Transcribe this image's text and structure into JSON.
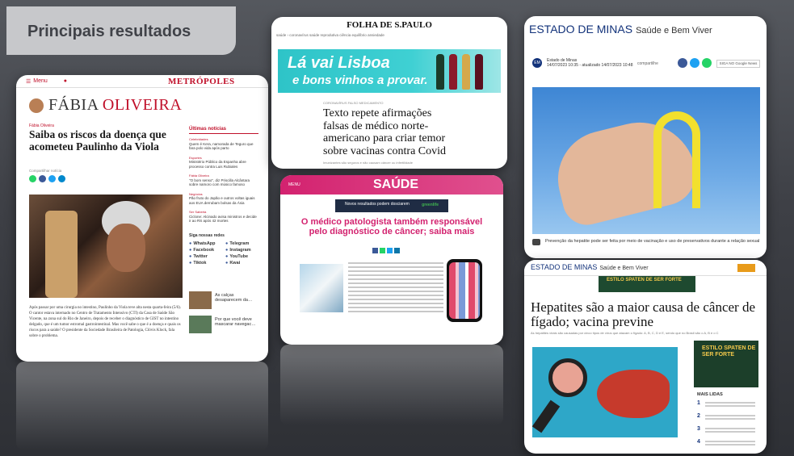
{
  "title": "Principais resultados",
  "colors": {
    "accent": "#c0102a",
    "saude": "#d3226f",
    "estado": "#12327a",
    "folha_ad": "#2ec4c8"
  },
  "metropoles": {
    "menu": "Menu",
    "logo": "METRÓPOLES",
    "author_first": "FÁBIA",
    "author_last": "OLIVEIRA",
    "category": "Fábia Oliveira",
    "headline": "Saiba os riscos da doença que acometeu Paulinho da Viola",
    "share_label": "Compartilhar notícia",
    "sidebar_title": "Últimas notícias",
    "sidebar_items": [
      {
        "tag": "Celebridades",
        "text": "Quem é Kera, namorada de Teguro que fara polo vida após parto"
      },
      {
        "tag": "Esportes",
        "text": "Ministério Público da Espanha abre processo contra Luis Rubiales"
      },
      {
        "tag": "Fábia Oliveira",
        "text": "\"O bom senso\", diz Priscilla Alcântara sobre namoro com músico famoso"
      },
      {
        "tag": "Negócios",
        "text": "Pão fruto do Japão e outros voltas iguais aos EUA derrubam bolsas da Ásia"
      },
      {
        "tag": "Ser Saberta",
        "text": "Ciclone: Alcinado avisa ministros e decide ir ao RS após 42 mortes"
      }
    ],
    "social_title": "Siga nossas redes",
    "social": [
      "WhatsApp",
      "Telegram",
      "Facebook",
      "Instagram",
      "Twitter",
      "YouTube",
      "Tiktok",
      "Kwai"
    ],
    "related": [
      {
        "text": "As calças desaparecem da…"
      },
      {
        "text": "Por que você deve mascarar navegac…"
      }
    ],
    "body": "Após passar por uma cirurgia no intestino, Paulinho da Viola teve alta nesta quarta-feira (5/6). O cantor estava internado no Centro de Tratamento Intensivo (CTI) da Casa de Saúde São Vicente, na zona sul do Rio de Janeiro, depois de receber o diagnóstico de GIST no intestino delgado, que é um tumor estromal gastrointestinal. Mas você sabe o que é a doença e quais os riscos para a saúde? O presidente da Sociedade Brasileira de Patologia, Clóvis Klock, fala sobre o problema."
  },
  "folha": {
    "logo": "FOLHA DE S.PAULO",
    "nav": "saúde  ›  coronavírus  saúde reprodutiva  ciência  equilíbrio  ansiedade",
    "ad_line1": "Lá vai Lisboa",
    "ad_line2": "e bons vinhos a provar.",
    "tags": "CORONAVÍRUS   FALSO MEDICAMENTO",
    "headline": "Texto repete afirmações falsas de médico norte-americano para criar temor sobre vacinas contra Covid",
    "sub": "Imunizantes são seguros e não causam câncer ou infertilidade"
  },
  "saude": {
    "menu": "MENU",
    "logo": "SAÚDE",
    "ad_left": "Novos resultados podem dosciarem",
    "ad_right": "greenlife",
    "headline": "O médico patologista também responsável pelo diagnóstico de câncer; saiba mais"
  },
  "estado_top": {
    "logo": "ESTADO DE MINAS",
    "section": "Saúde e Bem Viver",
    "author": "Estado de Minas",
    "date": "14/07/2023 10:35 - atualizado 14/07/2023 10:48",
    "share": "compartilhe",
    "google": "SIGA NO Google News",
    "caption": "Prevenção da hepatite pode ser feita por meio de vacinação e uso de preservativos durante a relação sexual"
  },
  "estado_bottom": {
    "logo": "ESTADO DE MINAS",
    "section": "Saúde e Bem Viver",
    "ad": "ESTILO SPATEN DE SER FORTE",
    "headline": "Hepatites são a maior causa de câncer de fígado; vacina previne",
    "sub": "As hepatites virais são causadas por cinco tipos de vírus que atacam o fígado: A, B, C, D e E, sendo que no Brasil são o A, B e o C",
    "ad2": "ESTILO SPATEN DE SER FORTE",
    "most_read": "MAIS LIDAS",
    "most_read_numbers": [
      "1",
      "2",
      "3",
      "4"
    ]
  }
}
